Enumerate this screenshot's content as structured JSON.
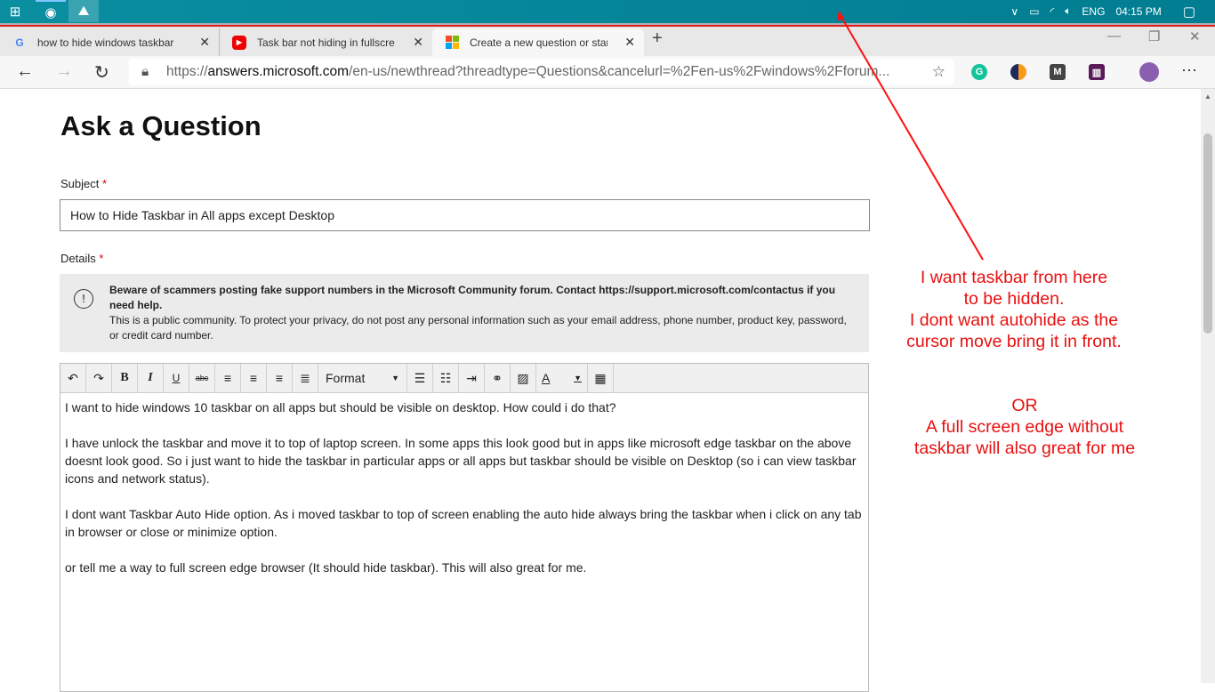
{
  "taskbar": {
    "tray": {
      "language": "ENG",
      "time": "04:15 PM"
    },
    "icons": [
      "windows-start-icon",
      "edge-icon",
      "photos-icon"
    ]
  },
  "tabs": [
    {
      "title": "how to hide windows taskbar in all apps",
      "favicon": "google-icon"
    },
    {
      "title": "Task bar not hiding in fullscreen Windows",
      "favicon": "youtube-icon"
    },
    {
      "title": "Create a new question or start a discussion",
      "favicon": "microsoft-icon"
    }
  ],
  "address": {
    "prefix": "https://",
    "host": "answers.microsoft.com",
    "rest": "/en-us/newthread?threadtype=Questions&cancelurl=%2Fen-us%2Fwindows%2Fforum..."
  },
  "page": {
    "title": "Ask a Question",
    "subject_label": "Subject",
    "required": "*",
    "subject_value": "How to Hide Taskbar in All apps except Desktop",
    "details_label": "Details",
    "notice_bold": "Beware of scammers posting fake support numbers in the Microsoft Community forum. Contact https://support.microsoft.com/contactus if you need help.",
    "notice_text": "This is a public community. To protect your privacy, do not post any personal information such as your email address, phone number, product key, password, or credit card number.",
    "format_label": "Format",
    "body": [
      "I want to hide windows 10 taskbar on all apps but should be visible on desktop. How could i do that?",
      "I have unlock the taskbar and move it to top of laptop screen. In some apps this look good but in apps like microsoft edge taskbar on the above doesnt look good. So i just want to hide the taskbar in particular apps or all apps but taskbar should be visible on Desktop (so i can view taskbar icons and network status).",
      "I dont want Taskbar Auto Hide option. As i moved taskbar to top of screen enabling the auto hide always bring the taskbar when i click on any tab in browser or close or minimize option.",
      "or tell me a way to full screen edge browser (It should hide taskbar). This will also great for me."
    ]
  },
  "annotation": {
    "line1": "I want taskbar from here",
    "line2": "to be hidden.",
    "line3": "I dont want autohide as the",
    "line4": "cursor move bring it in front.",
    "or": "OR",
    "line5": "A full screen edge without",
    "line6": "taskbar will also great for me",
    "color": "#e81010"
  }
}
